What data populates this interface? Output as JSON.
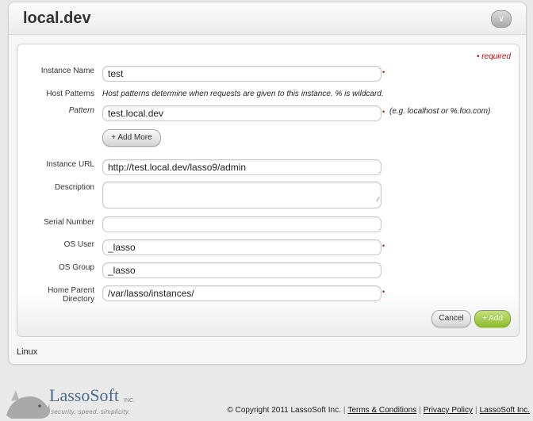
{
  "header": {
    "title": "local.dev"
  },
  "form": {
    "required_note": "required",
    "required_mark": "•",
    "instance_name": {
      "label": "Instance Name",
      "value": "test"
    },
    "host_patterns": {
      "label": "Host Patterns",
      "hint": "Host patterns determine when requests are given to this instance. % is wildcard."
    },
    "pattern": {
      "label": "Pattern",
      "value": "test.local.dev",
      "example": "(e.g. localhost or %.foo.com)"
    },
    "add_more_label": "+ Add More",
    "instance_url": {
      "label": "Instance URL",
      "value": "http://test.local.dev/lasso9/admin"
    },
    "description": {
      "label": "Description",
      "value": ""
    },
    "serial_number": {
      "label": "Serial Number",
      "value": ""
    },
    "os_user": {
      "label": "OS User",
      "value": "_lasso"
    },
    "os_group": {
      "label": "OS Group",
      "value": "_lasso"
    },
    "home_parent": {
      "label_line1": "Home Parent",
      "label_line2": "Directory",
      "value": "/var/lasso/instances/"
    },
    "cancel_label": "Cancel",
    "add_label": "+ Add"
  },
  "section_label": "Linux",
  "footer": {
    "logo_text": "LassoSoft",
    "logo_inc": "INC.",
    "logo_tagline": "security. speed. simplicity.",
    "copyright": "© Copyright 2011 LassoSoft Inc.",
    "links": [
      "Terms & Conditions",
      "Privacy Policy",
      "LassoSoft Inc."
    ]
  },
  "colors": {
    "required": "#cc0000",
    "add_button": "#8ebd2e",
    "logo": "#4b6a8d"
  },
  "icons": {
    "collapse": "chevron-down-icon",
    "logo": "rhino-logo-icon"
  }
}
